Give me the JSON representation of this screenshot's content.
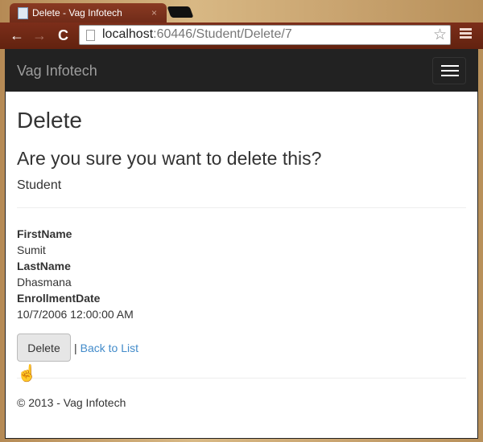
{
  "browser": {
    "tab_title": "Delete - Vag Infotech",
    "url_host": "localhost",
    "url_rest": ":60446/Student/Delete/7",
    "close": "×",
    "back": "←",
    "forward": "→",
    "reload": "C",
    "star": "☆"
  },
  "navbar": {
    "brand": "Vag Infotech"
  },
  "main": {
    "title": "Delete",
    "question": "Are you sure you want to delete this?",
    "entity": "Student",
    "fields": [
      {
        "label": "FirstName",
        "value": "Sumit"
      },
      {
        "label": "LastName",
        "value": "Dhasmana"
      },
      {
        "label": "EnrollmentDate",
        "value": "10/7/2006 12:00:00 AM"
      }
    ],
    "delete_label": "Delete",
    "separator": "|",
    "back_label": "Back to List"
  },
  "footer": {
    "text": "© 2013 - Vag Infotech"
  }
}
